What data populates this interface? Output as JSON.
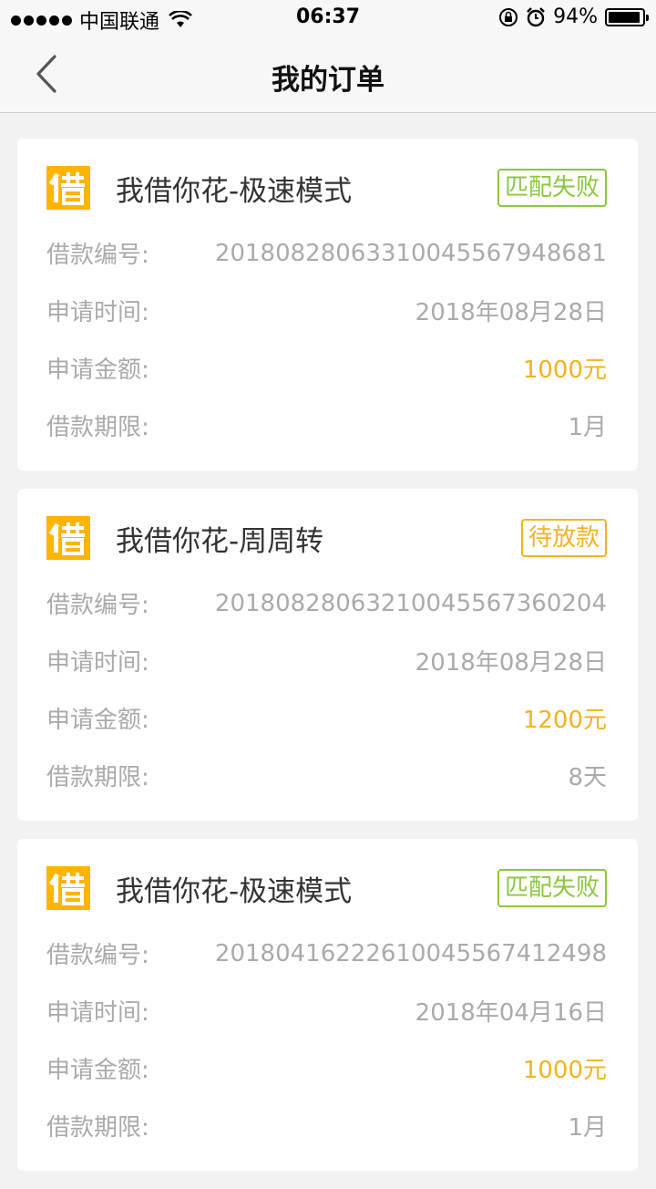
{
  "status_bar": {
    "carrier": "中国联通",
    "time": "06:37",
    "battery": "94%",
    "battery_level": 0.94
  },
  "nav": {
    "title": "我的订单",
    "back_icon": "chevron-left-icon"
  },
  "orders": [
    {
      "logo_char": "借",
      "product": "我借你花-极速模式",
      "status": "匹配失败",
      "rows": [
        {
          "label": "借款编号:",
          "value": "2018082806331004556794868​1"
        },
        {
          "label": "申请时间:",
          "value": "2018年08月28日"
        },
        {
          "label": "申请金额:",
          "value": "1000元"
        },
        {
          "label": "借款期限:",
          "value": "1月"
        }
      ]
    },
    {
      "logo_char": "借",
      "product": "我借你花-周周转",
      "status": "待放款",
      "rows": [
        {
          "label": "借款编号:",
          "value": "20180828063210045567360204"
        },
        {
          "label": "申请时间:",
          "value": "2018年08月28日"
        },
        {
          "label": "申请金额:",
          "value": "1200元"
        },
        {
          "label": "借款期限:",
          "value": "8天"
        }
      ]
    },
    {
      "logo_char": "借",
      "product": "我借你花-极速模式",
      "status": "匹配失败",
      "rows": [
        {
          "label": "借款编号:",
          "value": "20180416222610045567412498"
        },
        {
          "label": "申请时间:",
          "value": "2018年04月16日"
        },
        {
          "label": "申请金额:",
          "value": "1000元"
        },
        {
          "label": "借款期限:",
          "value": "1月"
        }
      ]
    }
  ],
  "colors": {
    "accent": "#f5b21d",
    "fail": "#8cc63f",
    "logo": "#ffb400"
  }
}
